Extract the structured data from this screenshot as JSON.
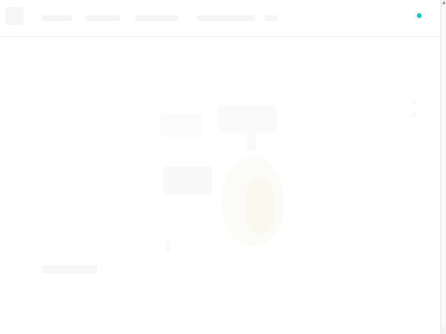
{
  "header": {
    "logo_icon": "brand-logo-icon",
    "nav_items": [
      "",
      "",
      "",
      "",
      ""
    ],
    "cart": {
      "icon": "shopping-bag-icon",
      "badge_color": "#21c2c8"
    }
  },
  "hero": {
    "mascot_icon": "mascot-illustration",
    "background": "#ffffff"
  },
  "scrollbar": {
    "up_arrow_icon": "chevron-up-icon"
  },
  "colors": {
    "accent": "#21c2c8",
    "divider": "#ededed"
  }
}
